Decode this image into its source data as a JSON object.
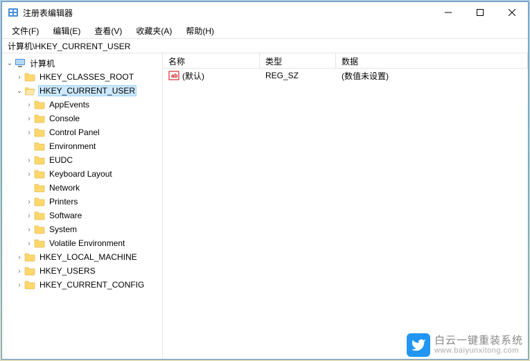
{
  "window": {
    "title": "注册表编辑器"
  },
  "menu": {
    "file": "文件(F)",
    "edit": "编辑(E)",
    "view": "查看(V)",
    "favorites": "收藏夹(A)",
    "help": "帮助(H)"
  },
  "address": "计算机\\HKEY_CURRENT_USER",
  "tree": {
    "root": "计算机",
    "hkcr": "HKEY_CLASSES_ROOT",
    "hkcu": "HKEY_CURRENT_USER",
    "children": {
      "appevents": "AppEvents",
      "console": "Console",
      "controlpanel": "Control Panel",
      "environment": "Environment",
      "eudc": "EUDC",
      "keyboard": "Keyboard Layout",
      "network": "Network",
      "printers": "Printers",
      "software": "Software",
      "system": "System",
      "volatile": "Volatile Environment"
    },
    "hklm": "HKEY_LOCAL_MACHINE",
    "hku": "HKEY_USERS",
    "hkcc": "HKEY_CURRENT_CONFIG"
  },
  "list": {
    "header": {
      "name": "名称",
      "type": "类型",
      "data": "数据"
    },
    "row0": {
      "name": "(默认)",
      "type": "REG_SZ",
      "data": "(数值未设置)"
    }
  },
  "watermark": {
    "line1": "白云一键重装系统",
    "line2": "www.baiyunxitong.com"
  }
}
